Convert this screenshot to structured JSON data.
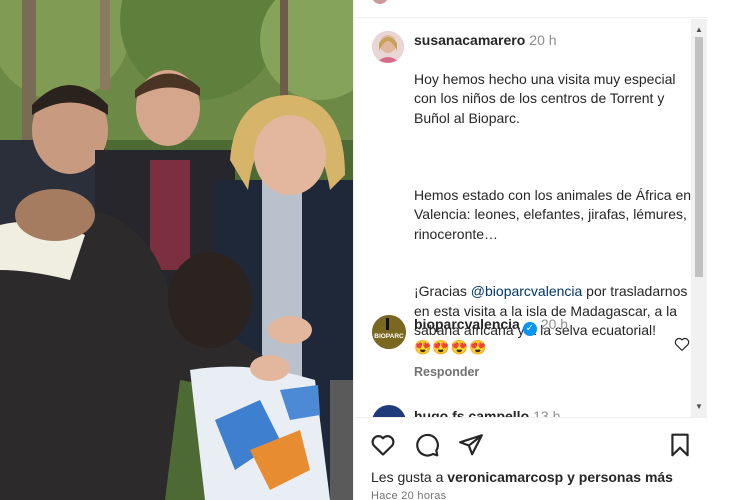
{
  "post": {
    "author": "susanacamarero",
    "time": "20 h",
    "caption_line1": "Hoy hemos hecho una visita muy especial con los niños de los centros de Torrent y Buñol al Bioparc.",
    "caption_line2": "Hemos estado con los animales de África en Valencia: leones, elefantes, jirafas, lémures, rinoceronte…",
    "caption_line3_pre": "¡Gracias ",
    "caption_mention": "@bioparcvalencia",
    "caption_line3_post": " por trasladarnos en esta visita a la isla de Madagascar, a la sabana africana y a la selva ecuatorial!"
  },
  "comments": [
    {
      "author": "bioparcvalencia",
      "avatar_text": "BIOPARC",
      "verified": true,
      "time": "20 h",
      "text": "😍😍😍😍",
      "reply_label": "Responder"
    },
    {
      "author": "hugo.fs.campello",
      "time": "13 h"
    }
  ],
  "footer": {
    "likes_prefix": "Les gusta a ",
    "likes_user": "veronicamarcosp",
    "likes_suffix": " y personas más",
    "ago": "Hace 20 horas"
  },
  "icons": {
    "like": "heart-icon",
    "comment": "comment-icon",
    "share": "share-icon",
    "save": "bookmark-icon"
  },
  "colors": {
    "mention": "#00376b",
    "verified": "#0095f6",
    "muted": "#8e8e8e"
  }
}
